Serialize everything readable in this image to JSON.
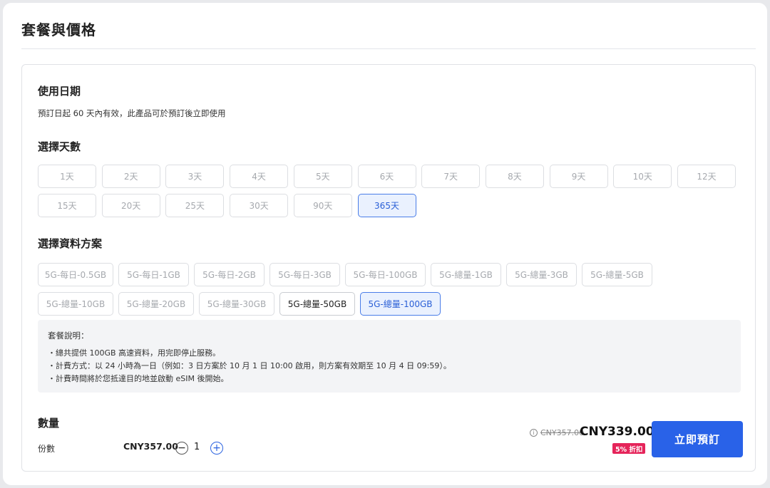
{
  "page_title": "套餐與價格",
  "usage": {
    "title": "使用日期",
    "desc": "預訂日起 60 天內有效，此產品可於預訂後立即使用"
  },
  "days": {
    "title": "選擇天數",
    "options": [
      "1天",
      "2天",
      "3天",
      "4天",
      "5天",
      "6天",
      "7天",
      "8天",
      "9天",
      "10天",
      "12天",
      "15天",
      "20天",
      "25天",
      "30天",
      "90天",
      "365天"
    ],
    "selected": "365天"
  },
  "plans": {
    "title": "選擇資料方案",
    "options": [
      "5G-每日-0.5GB",
      "5G-每日-1GB",
      "5G-每日-2GB",
      "5G-每日-3GB",
      "5G-每日-100GB",
      "5G-總量-1GB",
      "5G-總量-3GB",
      "5G-總量-5GB",
      "5G-總量-10GB",
      "5G-總量-20GB",
      "5G-總量-30GB",
      "5G-總量-50GB",
      "5G-總量-100GB"
    ],
    "available": "5G-總量-50GB",
    "selected": "5G-總量-100GB"
  },
  "notes": {
    "title": "套餐說明：",
    "lines": [
      "・總共提供 100GB 高速資料，用完即停止服務。",
      "・計費方式：以 24 小時為一日（例如：3 日方案於 10 月 1 日 10:00 啟用，則方案有效期至 10 月 4 日 09:59）。",
      "・計費時間將於您抵達目的地並啟動 eSIM 後開始。"
    ]
  },
  "quantity": {
    "title": "數量",
    "label": "份數",
    "unit_price": "CNY357.00",
    "value": "1",
    "minus_icon": "minus-circle-icon",
    "plus_icon": "plus-circle-icon"
  },
  "pricing": {
    "original": "CNY357.00",
    "final": "CNY339.00",
    "discount": "5% 折扣",
    "info_icon": "info-icon"
  },
  "book_button": "立即預訂",
  "colors": {
    "accent": "#2962e8",
    "selected_bg": "#eaf1fe",
    "discount": "#e5245a"
  }
}
